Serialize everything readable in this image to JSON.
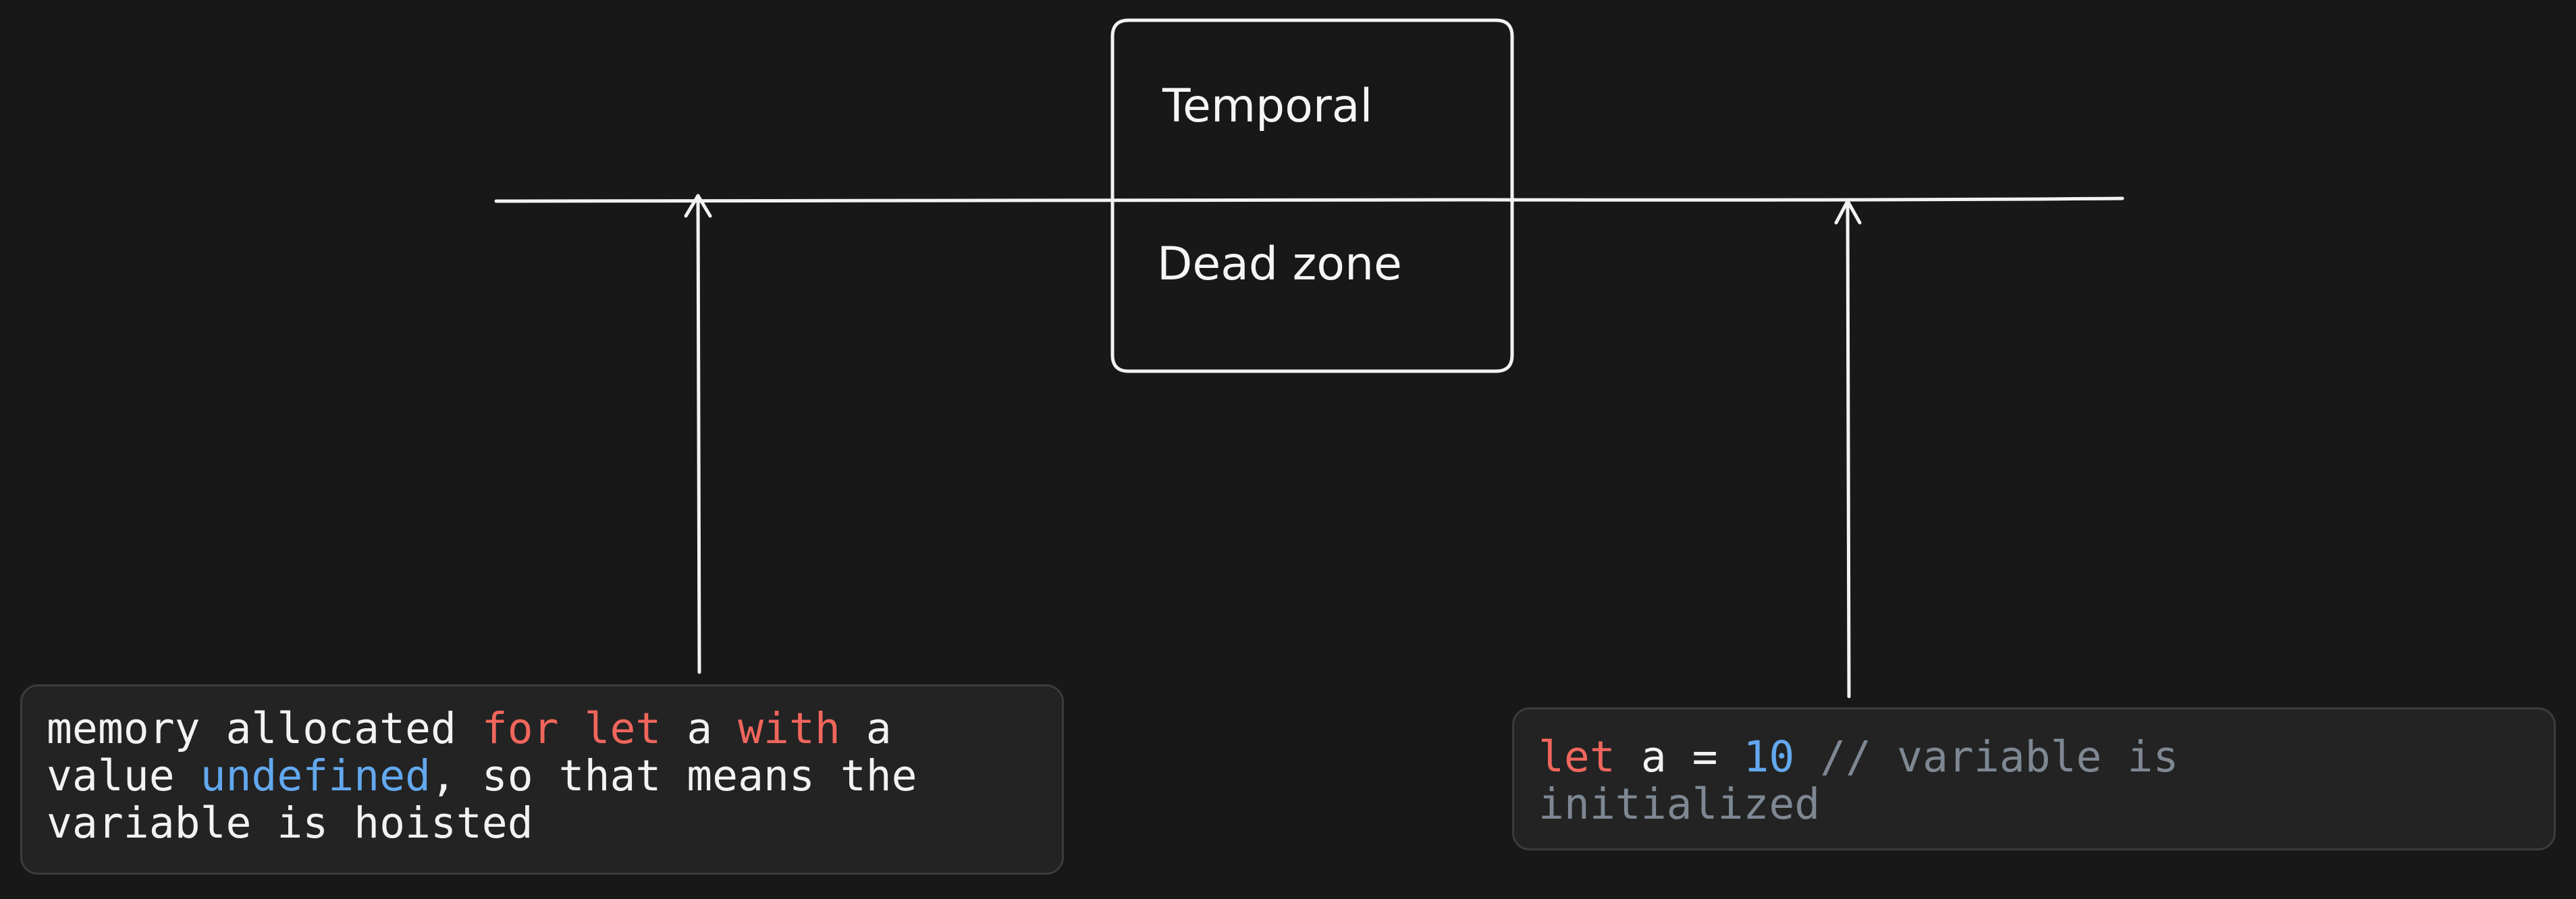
{
  "diagram": {
    "box_labels": {
      "top": "Temporal",
      "bottom": "Dead zone"
    }
  },
  "notes": {
    "left": {
      "line1": {
        "a": "memory allocated ",
        "kw_for": "for",
        "b": " ",
        "kw_let": "let",
        "c": " a ",
        "kw_with": "with",
        "d": " a"
      },
      "line2": {
        "a": "value ",
        "val_undefined": "undefined",
        "b": ", so that means the"
      },
      "line3": "variable is hoisted"
    },
    "right": {
      "line1": {
        "kw_let": "let",
        "a": " a = ",
        "val_10": "10",
        "b": " ",
        "comment": "// variable is"
      },
      "line2": {
        "comment": "initialized"
      }
    }
  },
  "colors": {
    "background": "#181818",
    "stroke": "#f2f2f2",
    "keyword": "#f0665c",
    "value": "#62a8ee",
    "comment": "#7e8893",
    "note_background": "#232323",
    "note_border": "#3c3c3c"
  }
}
